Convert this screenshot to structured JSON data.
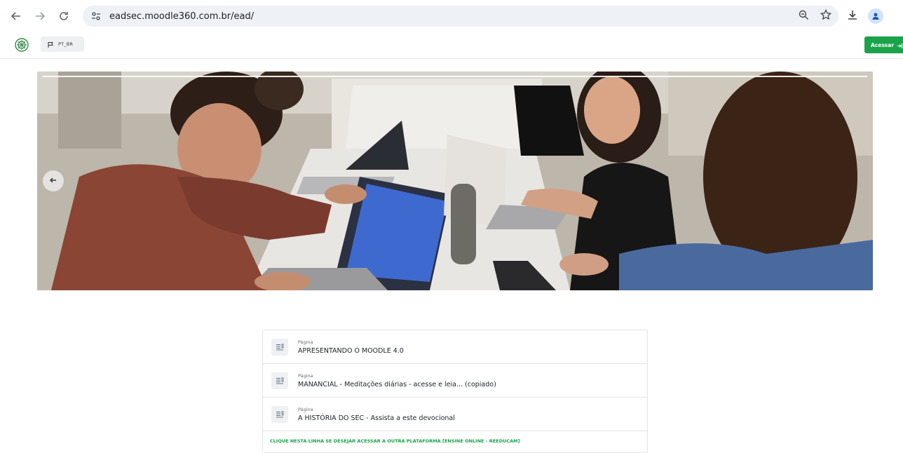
{
  "browser": {
    "url": "eadsec.moodle360.com.br/ead/",
    "icons": [
      "back-arrow-icon",
      "forward-arrow-icon",
      "reload-icon",
      "site-settings-icon",
      "zoom-icon",
      "star-icon",
      "download-icon",
      "profile-icon"
    ]
  },
  "header": {
    "language_label": "PT_BR",
    "login_label": "Acessar",
    "accent_color": "#1aa34a"
  },
  "hero": {
    "prev_icon": "arrow-left-icon"
  },
  "course_list": {
    "items": [
      {
        "kind": "Página",
        "title": "APRESENTANDO O MOODLE 4.0"
      },
      {
        "kind": "Página",
        "title": "MANANCIAL - Meditações diárias - acesse e leia... (copiado)"
      },
      {
        "kind": "Página",
        "title": "A HISTÓRIA DO SEC - Assista a este devocional"
      }
    ],
    "platform_link": "CLIQUE NESTA LINHA SE DESEJAR ACESSAR A OUTRA PLATAFORMA [ENSINE ONLINE - REEDUCAM]"
  }
}
